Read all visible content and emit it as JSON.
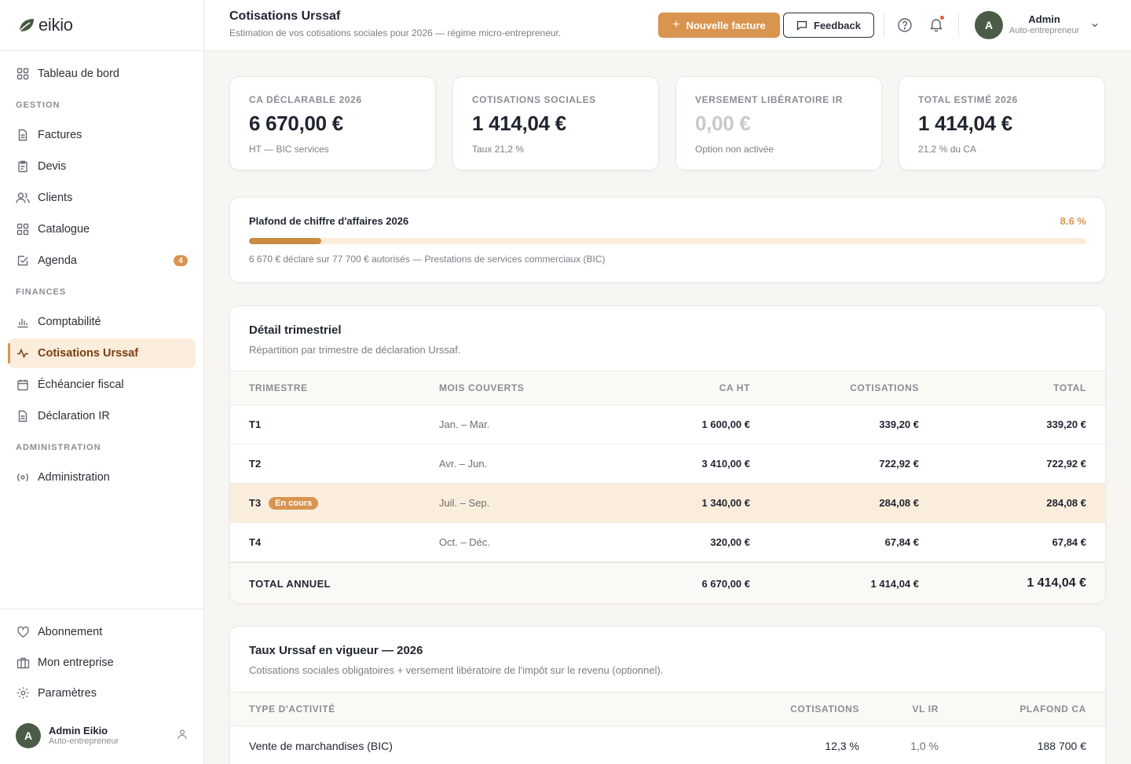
{
  "brand": {
    "name": "eikio",
    "accent": "#d9944f"
  },
  "sidebar": {
    "top_item": {
      "label": "Tableau de bord",
      "icon": "grid-icon"
    },
    "sections": [
      {
        "title": "GESTION",
        "items": [
          {
            "label": "Factures",
            "icon": "document-icon"
          },
          {
            "label": "Devis",
            "icon": "clipboard-icon"
          },
          {
            "label": "Clients",
            "icon": "users-icon"
          },
          {
            "label": "Catalogue",
            "icon": "grid-icon"
          },
          {
            "label": "Agenda",
            "icon": "checkbox-icon",
            "badge": "4"
          }
        ]
      },
      {
        "title": "FINANCES",
        "items": [
          {
            "label": "Comptabilité",
            "icon": "bar-chart-icon"
          },
          {
            "label": "Cotisations Urssaf",
            "icon": "activity-icon",
            "active": true
          },
          {
            "label": "Échéancier fiscal",
            "icon": "calendar-icon"
          },
          {
            "label": "Déclaration IR",
            "icon": "document-icon"
          }
        ]
      },
      {
        "title": "ADMINISTRATION",
        "items": [
          {
            "label": "Administration",
            "icon": "radio-icon"
          }
        ]
      }
    ],
    "bottom_items": [
      {
        "label": "Abonnement",
        "icon": "heart-icon"
      },
      {
        "label": "Mon entreprise",
        "icon": "briefcase-icon"
      },
      {
        "label": "Paramètres",
        "icon": "gear-icon"
      }
    ],
    "user": {
      "initial": "A",
      "name": "Admin Eikio",
      "role": "Auto-entrepreneur"
    }
  },
  "header": {
    "title": "Cotisations Urssaf",
    "subtitle": "Estimation de vos cotisations sociales pour 2026 — régime micro-entrepreneur.",
    "new_invoice": "Nouvelle facture",
    "feedback": "Feedback",
    "user": {
      "initial": "A",
      "name": "Admin",
      "role": "Auto-entrepreneur"
    }
  },
  "kpis": [
    {
      "label": "CA DÉCLARABLE 2026",
      "value": "6 670,00 €",
      "sub": "HT — BIC services"
    },
    {
      "label": "COTISATIONS SOCIALES",
      "value": "1 414,04 €",
      "sub": "Taux 21,2 %"
    },
    {
      "label": "VERSEMENT LIBÉRATOIRE IR",
      "value": "0,00 €",
      "sub": "Option non activée"
    },
    {
      "label": "TOTAL ESTIMÉ 2026",
      "value": "1 414,04 €",
      "sub": "21,2 % du CA"
    }
  ],
  "plafond": {
    "title": "Plafond de chiffre d'affaires 2026",
    "percent_label": "8.6 %",
    "progress_fraction": 0.086,
    "note": "6 670 € déclaré sur 77 700 € autorisés — Prestations de services commerciaux (BIC)"
  },
  "detail": {
    "title": "Détail trimestriel",
    "subtitle": "Répartition par trimestre de déclaration Urssaf.",
    "headers": [
      "TRIMESTRE",
      "MOIS COUVERTS",
      "CA HT",
      "COTISATIONS",
      "TOTAL"
    ],
    "rows": [
      {
        "q": "T1",
        "months": "Jan. – Mar.",
        "ca": "1 600,00 €",
        "cot": "339,20 €",
        "total": "339,20 €"
      },
      {
        "q": "T2",
        "months": "Avr. – Jun.",
        "ca": "3 410,00 €",
        "cot": "722,92 €",
        "total": "722,92 €"
      },
      {
        "q": "T3",
        "months": "Juil. – Sep.",
        "ca": "1 340,00 €",
        "cot": "284,08 €",
        "total": "284,08 €",
        "badge": "En cours"
      },
      {
        "q": "T4",
        "months": "Oct. – Déc.",
        "ca": "320,00 €",
        "cot": "67,84 €",
        "total": "67,84 €"
      }
    ],
    "total_row": {
      "label": "TOTAL ANNUEL",
      "ca": "6 670,00 €",
      "cot": "1 414,04 €",
      "total": "1 414,04 €"
    }
  },
  "taux": {
    "title": "Taux Urssaf en vigueur — 2026",
    "subtitle": "Cotisations sociales obligatoires + versement libératoire de l'impôt sur le revenu (optionnel).",
    "headers": [
      "TYPE D'ACTIVITÉ",
      "COTISATIONS",
      "VL IR",
      "PLAFOND CA"
    ],
    "rows": [
      {
        "type": "Vente de marchandises (BIC)",
        "cot": "12,3 %",
        "vl": "1,0 %",
        "plafond": "188 700 €"
      }
    ]
  }
}
